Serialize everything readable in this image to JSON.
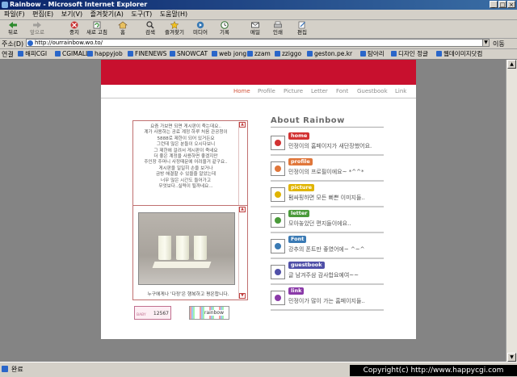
{
  "window": {
    "title": "Rainbow - Microsoft Internet Explorer"
  },
  "menubar": [
    "파일(F)",
    "편집(E)",
    "보기(V)",
    "즐겨찾기(A)",
    "도구(T)",
    "도움말(H)"
  ],
  "toolbar": [
    {
      "label": "뒤로",
      "icon": "back-arrow-icon"
    },
    {
      "label": "앞으로",
      "icon": "forward-arrow-icon"
    },
    {
      "label": "중지",
      "icon": "stop-icon"
    },
    {
      "label": "새로 고침",
      "icon": "refresh-icon"
    },
    {
      "label": "홈",
      "icon": "home-icon"
    },
    {
      "label": "검색",
      "icon": "search-icon"
    },
    {
      "label": "즐겨찾기",
      "icon": "favorites-icon"
    },
    {
      "label": "미디어",
      "icon": "media-icon"
    },
    {
      "label": "기록",
      "icon": "history-icon"
    },
    {
      "label": "메일",
      "icon": "mail-icon"
    },
    {
      "label": "인쇄",
      "icon": "print-icon"
    },
    {
      "label": "편집",
      "icon": "edit-icon"
    }
  ],
  "address": {
    "label": "주소(D)",
    "url": "http://ourrainbow.wo.to/",
    "go": "이동"
  },
  "links": {
    "label": "연결",
    "items": [
      "해피CGI",
      "CGIMALL",
      "happyjob",
      "FINENEWS",
      "SNOWCAT",
      "web jong",
      "zzam",
      "zziggo",
      "geston.pe.kr",
      "탐아리",
      "디자인 정글",
      "웹데이미지닷컴"
    ]
  },
  "site": {
    "nav": [
      "Home",
      "Profile",
      "Picture",
      "Letter",
      "Font",
      "Guestbook",
      "Link"
    ],
    "intro_lines": [
      "요즘 가보면 되면 게시판이 죽는데요..",
      "계가 사용하는 공료 계정 하루 처음 관공청이",
      "5888로 제한이 되어 있거든요",
      "그런데 많은 분들이 오시다보니",
      "그 제한에 걸려서 게시판이 죽네요",
      "더 좋은 계정을 사용하면 좋겠지만",
      "주인장 주머니 사정때문에 어려울거 같구요..",
      "게시판을 일일히 손을 보거나",
      "금방 해결할 수 있을줄 알았는데",
      "너무 많은 시간도 들어가고",
      "무엇보다..실력이 될까네요..."
    ],
    "photo_caption": "누구에게나 '다정'은 행복하고 평온합니다.",
    "counter": {
      "label": "BABY",
      "value": "12567"
    },
    "banner": "rainbow",
    "about_title": "About Rainbow",
    "items": [
      {
        "head": "home",
        "desc": "민정이의 홈페이지가 새단장했어요.",
        "color": "#d23232",
        "icon": "cherry-icon"
      },
      {
        "head": "profile",
        "desc": "민정이의 프로필이에요~ *^^*",
        "color": "#e0763a",
        "icon": "cookie-icon"
      },
      {
        "head": "picture",
        "desc": "펌싸핑하면 모든 뻐쁜 이미지들..",
        "color": "#e0b400",
        "icon": "lemon-icon"
      },
      {
        "head": "letter",
        "desc": "모아놓았던 편지들이에요..",
        "color": "#4a9a3a",
        "icon": "apple-icon"
      },
      {
        "head": "Font",
        "desc": "강추의 폰트만 좋였어에~ ^~^",
        "color": "#3a7ab4",
        "icon": "waterdrop-icon"
      },
      {
        "head": "guestbook",
        "desc": "글 남겨주삼 감사합요예여~~",
        "color": "#5050a8",
        "icon": "hand-icon"
      },
      {
        "head": "link",
        "desc": "민정이가 많이 가는 홈페이지들..",
        "color": "#8a3aa8",
        "icon": "grapes-icon"
      }
    ]
  },
  "status": {
    "text": "완료"
  },
  "watermark": "Copyright(c) http://www.happycgi.com"
}
